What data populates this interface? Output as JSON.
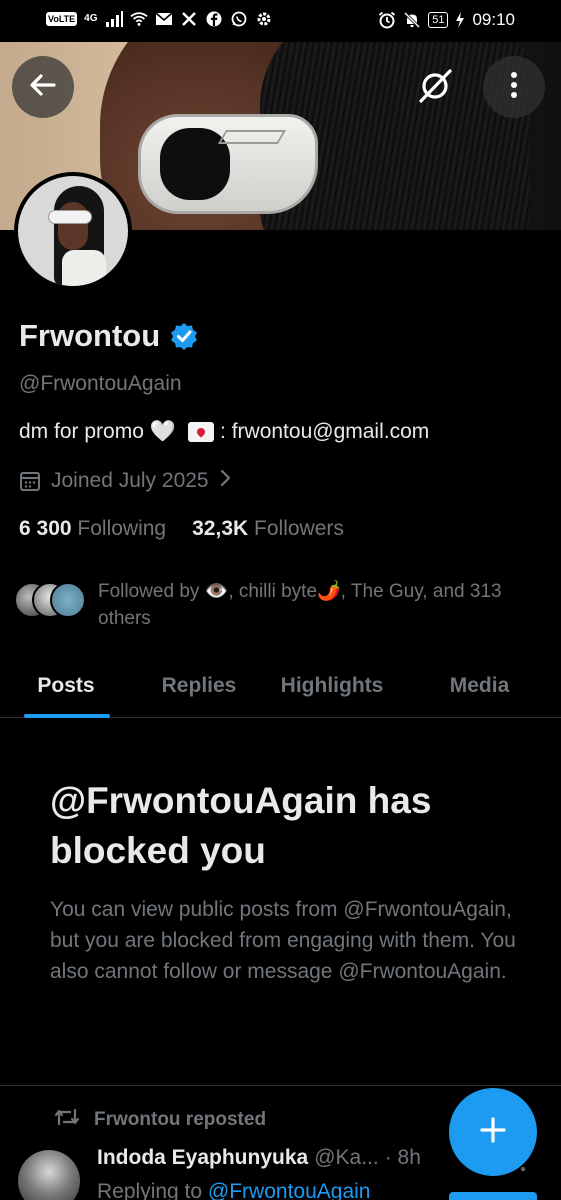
{
  "status_bar": {
    "volte": "VoLTE",
    "network": "4G",
    "battery": "51",
    "time": "09:10"
  },
  "profile": {
    "display_name": "Frwontou",
    "handle": "@FrwontouAgain",
    "bio_prefix": "dm for promo",
    "bio_email": ": frwontou@gmail.com",
    "joined": "Joined July 2025",
    "following_count": "6 300",
    "following_label": "Following",
    "followers_count": "32,3K",
    "followers_label": "Followers",
    "followed_by": "Followed by 👁️, chilli byte🌶️, The Guy, and 313 others"
  },
  "tabs": [
    {
      "label": "Posts",
      "active": true
    },
    {
      "label": "Replies",
      "active": false
    },
    {
      "label": "Highlights",
      "active": false
    },
    {
      "label": "Media",
      "active": false
    }
  ],
  "blocked": {
    "title": "@FrwontouAgain has blocked you",
    "body": "You can view public posts from @FrwontouAgain, but you are blocked from engaging with them. You also cannot follow or message @FrwontouAgain."
  },
  "timeline": {
    "repost_label": "Frwontou reposted",
    "author_name": "Indoda Eyaphunyuka",
    "author_handle": "@Ka...",
    "time": "· 8h",
    "replying_prefix": "Replying to",
    "replying_to": "@FrwontouAgain"
  },
  "icons": {
    "back": "arrow-left-icon",
    "grok": "grok-icon",
    "more": "more-vertical-icon",
    "verified": "verified-badge-icon",
    "calendar": "calendar-icon",
    "chevron": "chevron-right-icon",
    "repost": "repost-icon",
    "compose": "plus-icon"
  },
  "colors": {
    "accent": "#1d9bf0",
    "secondary_text": "#71767b",
    "primary_text": "#e7e9ea",
    "background": "#000000"
  }
}
